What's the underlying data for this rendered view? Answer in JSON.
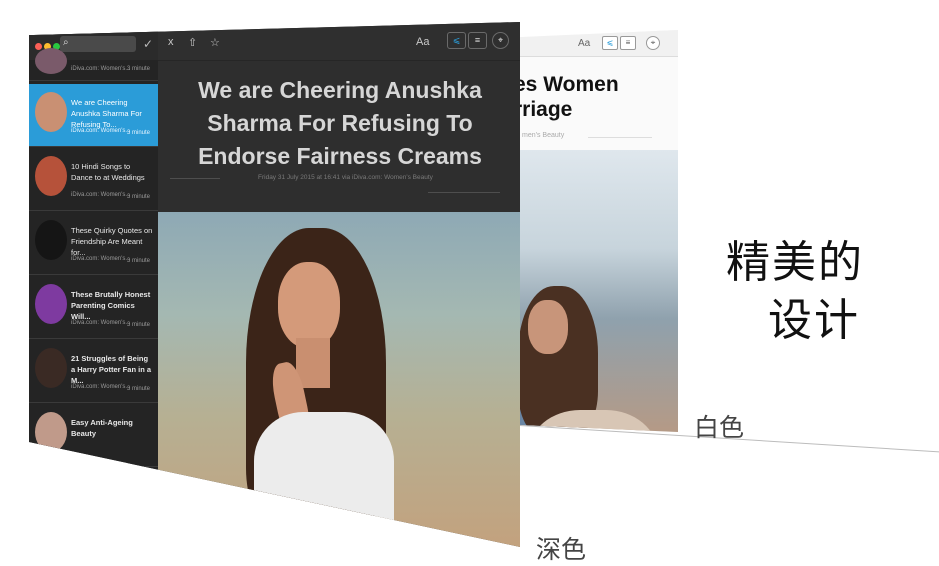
{
  "white_window": {
    "toolbar": {
      "font_label": "Aa",
      "rss_icon": "rss-icon",
      "list_icon": "list-icon",
      "compass_icon": "compass-icon"
    },
    "title_visible": "es Women rriage",
    "meta_visible": "men's Beauty"
  },
  "dark_window": {
    "sidebar": {
      "check_glyph": "✓",
      "items": [
        {
          "title": "",
          "source": "iDiva.com: Women's...",
          "time": "3 minute",
          "thumb_color": "#7a5a6a"
        },
        {
          "title": "We are Cheering Anushka Sharma For Refusing To...",
          "source": "iDiva.com: Women's...",
          "time": "3 minute",
          "thumb_color": "#c99073",
          "selected": true
        },
        {
          "title": "10 Hindi Songs to Dance to at Weddings",
          "source": "iDiva.com: Women's...",
          "time": "3 minute",
          "thumb_color": "#b6523a"
        },
        {
          "title": "These Quirky Quotes on Friendship Are Meant for...",
          "source": "iDiva.com: Women's...",
          "time": "3 minute",
          "thumb_color": "#151515"
        },
        {
          "title": "These Brutally Honest Parenting Comics Will...",
          "source": "iDiva.com: Women's...",
          "time": "3 minute",
          "thumb_color": "#7e3aa0",
          "bold": true
        },
        {
          "title": "21 Struggles of Being a Harry Potter Fan in a M...",
          "source": "iDiva.com: Women's...",
          "time": "3 minute",
          "thumb_color": "#3a2a24",
          "bold": true
        },
        {
          "title": "Easy Anti-Ageing Beauty",
          "source": "",
          "time": "",
          "thumb_color": "#c09a8a",
          "bold": true
        }
      ]
    },
    "toolbar": {
      "close": "x",
      "share": "⇧",
      "star": "☆",
      "font_label": "Aa"
    },
    "article": {
      "title": "We are Cheering Anushka Sharma For Refusing To Endorse Fairness Creams",
      "meta": "Friday 31 July 2015 at 16:41 via iDiva.com: Women's Beauty"
    }
  },
  "captions": {
    "line1": "精美的",
    "line2": "设计",
    "white_label": "白色",
    "dark_label": "深色"
  }
}
